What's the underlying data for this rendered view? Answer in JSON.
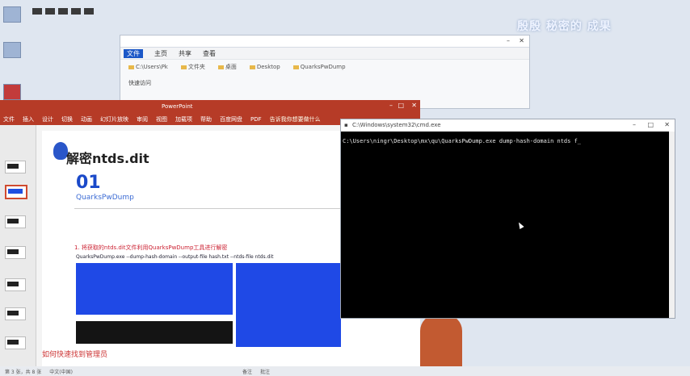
{
  "watermark": "殷殷 秘密的 成果",
  "explorer": {
    "tabs": [
      "文件",
      "主页",
      "共享",
      "查看"
    ],
    "quick_items": [
      "C:\\Users\\Pk",
      "文件夹",
      "桌面",
      "Desktop",
      "QuarksPwDump"
    ],
    "nav_label": "快速访问"
  },
  "ppt": {
    "title": "PowerPoint",
    "menu": [
      "文件",
      "插入",
      "设计",
      "切换",
      "动画",
      "幻灯片放映",
      "审阅",
      "视图",
      "加载项",
      "帮助",
      "百度网盘",
      "PDF",
      "告诉我你想要做什么"
    ],
    "slide": {
      "title": "解密ntds.dit",
      "number": "01",
      "subtitle": "QuarksPwDump",
      "note": "1. 将获取的ntds.dit文件利用QuarksPwDump工具进行解密",
      "command": "QuarksPwDump.exe --dump-hash-domain --output-file hash.txt --ntds-file ntds.dit",
      "footer": "如何快速找到管理员"
    }
  },
  "console": {
    "title": "C:\\Windows\\system32\\cmd.exe",
    "command_line": "C:\\Users\\ningr\\Desktop\\mx\\qu\\QuarksPwDump.exe   dump-hash-domain   ntds f_"
  },
  "taskbar": {
    "items": [
      "第 3 张，共 8 张",
      "中文(中国)",
      "备注",
      "批注"
    ]
  },
  "colors": {
    "ppt_red": "#b63b27",
    "slide_blue": "#1a49c9",
    "console_bg": "#000000"
  }
}
